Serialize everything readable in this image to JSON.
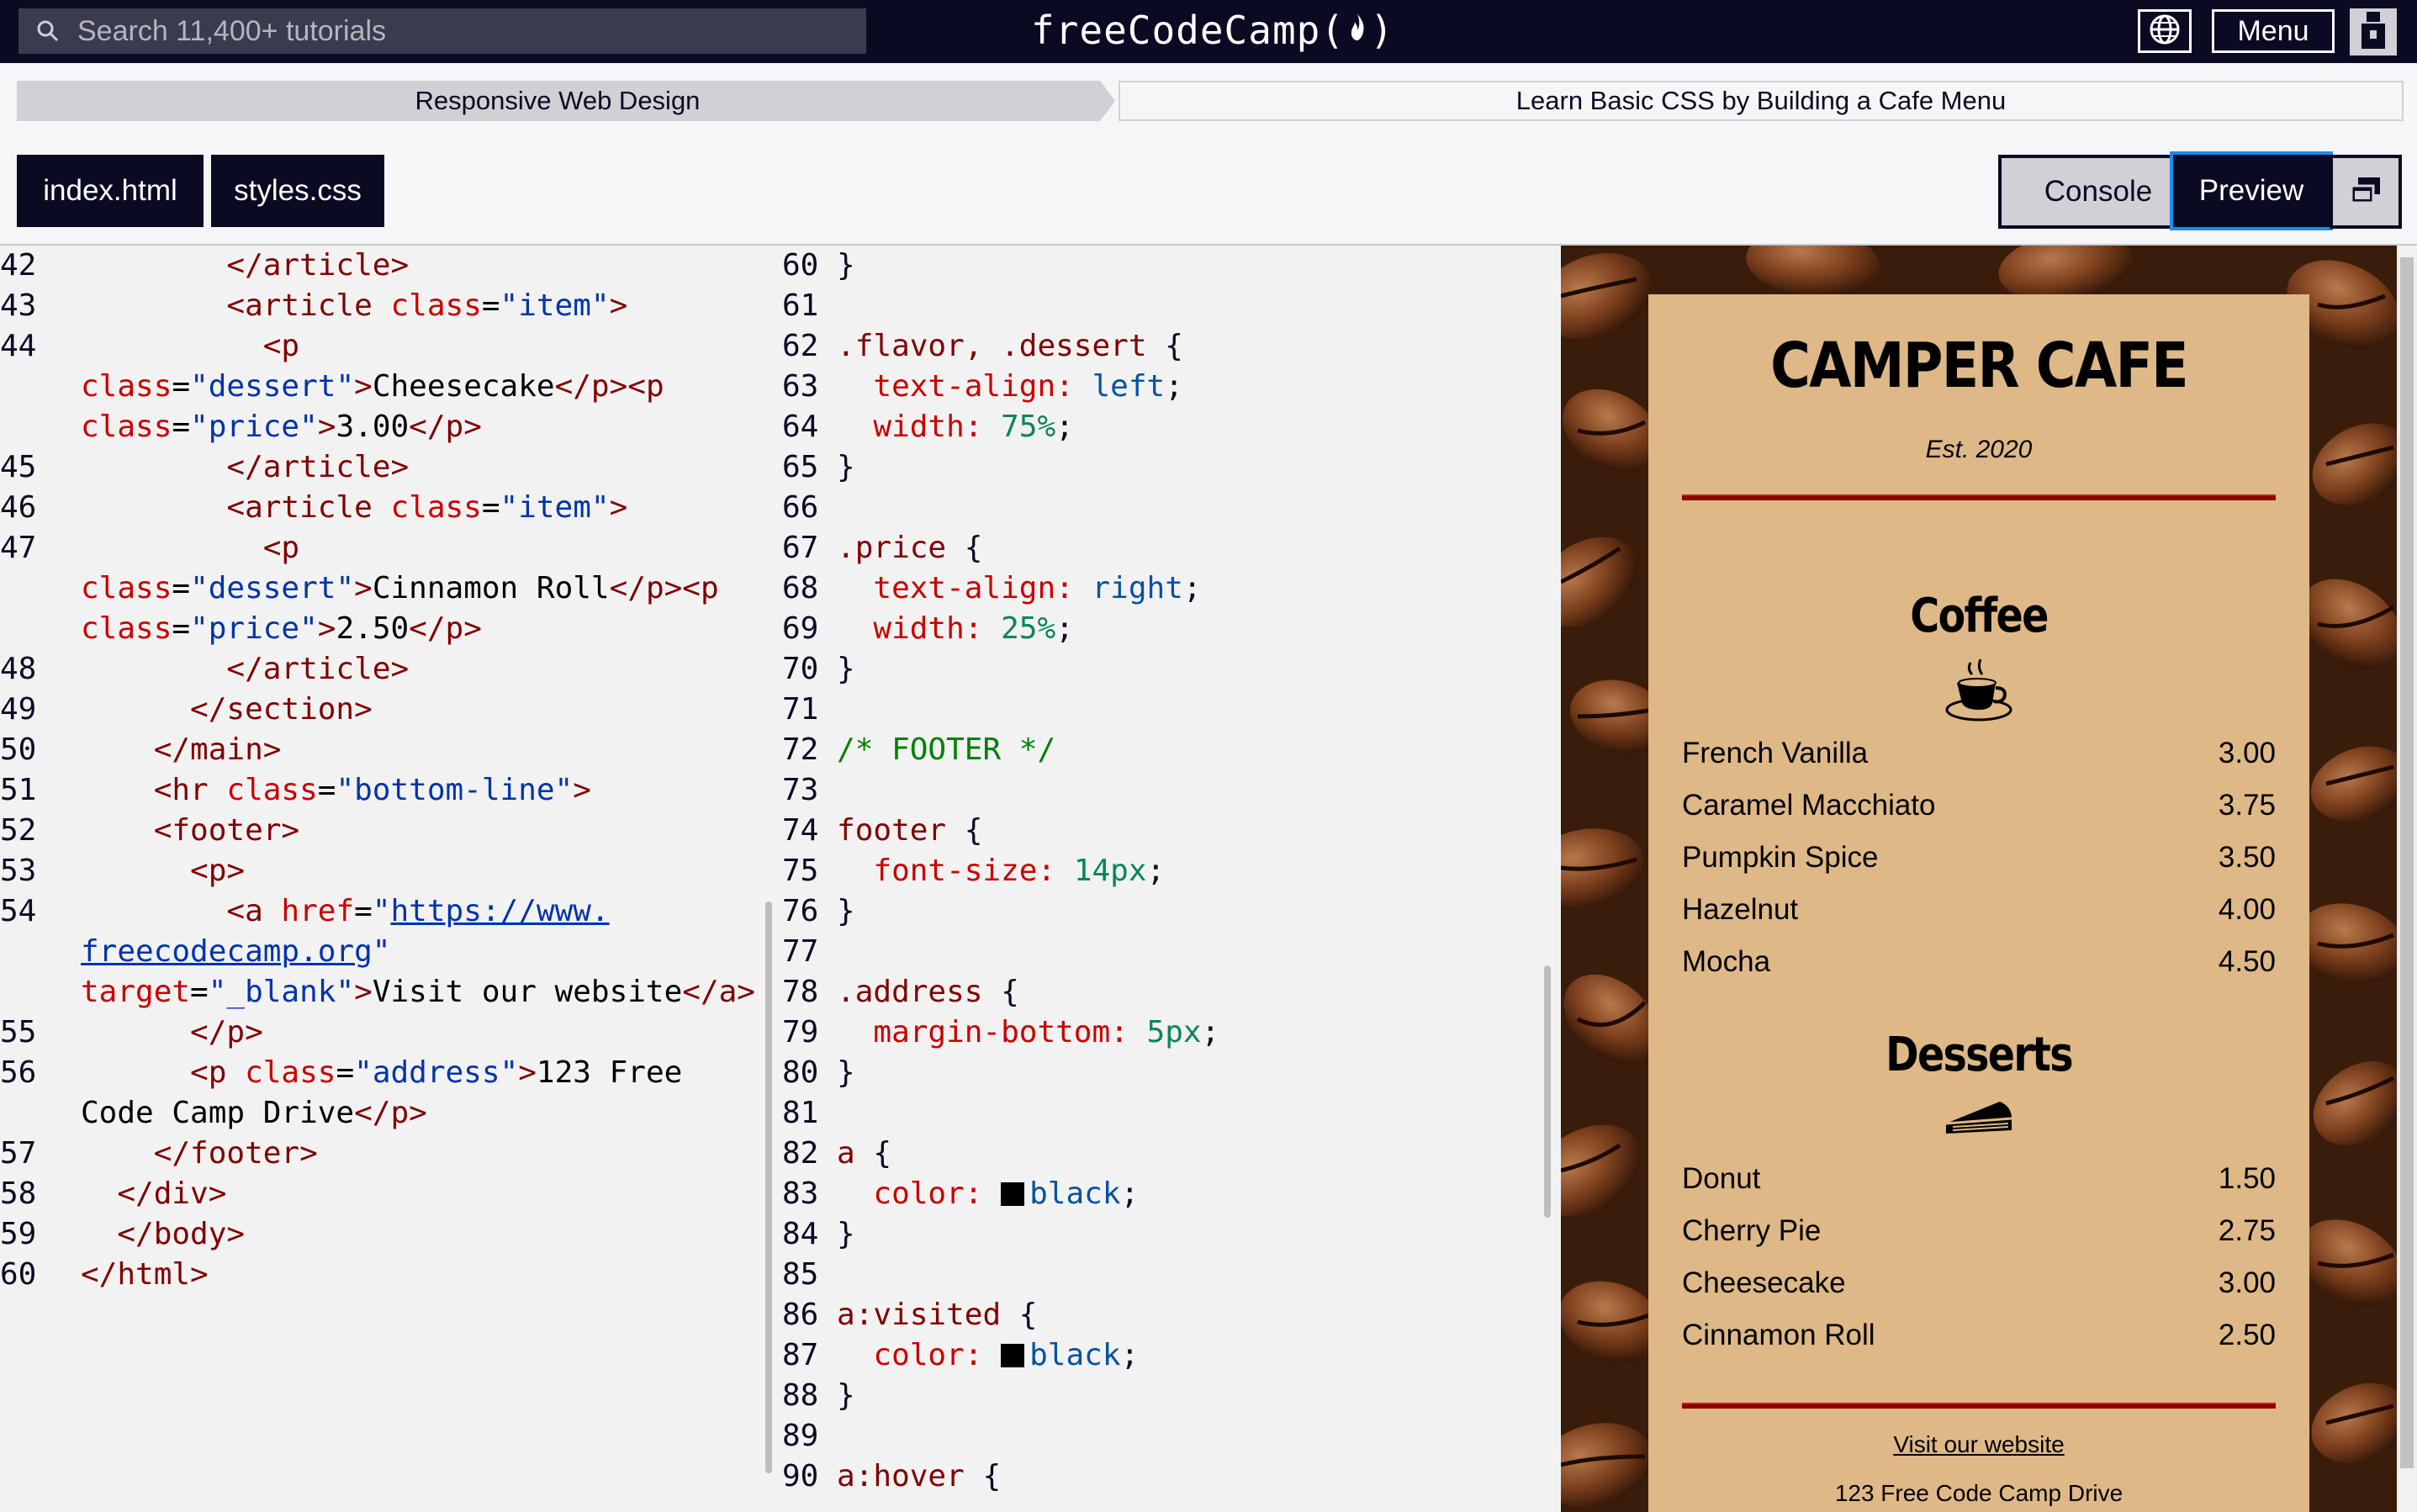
{
  "topnav": {
    "search_placeholder": "Search 11,400+ tutorials",
    "logo_text": "freeCodeCamp",
    "menu_label": "Menu"
  },
  "breadcrumb": {
    "superblock": "Responsive Web Design",
    "block": "Learn Basic CSS by Building a Cafe Menu"
  },
  "editor_tabs": [
    {
      "label": "index.html"
    },
    {
      "label": "styles.css"
    }
  ],
  "buttons": {
    "console": "Console",
    "preview": "Preview"
  },
  "html_editor": {
    "lines": [
      {
        "n": "42",
        "code": "        </article>"
      },
      {
        "n": "43",
        "code": "        <article class=\"item\">"
      },
      {
        "n": "44",
        "code": "          <p"
      },
      {
        "n": "",
        "code": "class=\"dessert\">Cheesecake</p><p"
      },
      {
        "n": "",
        "code": "class=\"price\">3.00</p>"
      },
      {
        "n": "45",
        "code": "        </article>"
      },
      {
        "n": "46",
        "code": "        <article class=\"item\">"
      },
      {
        "n": "47",
        "code": "          <p"
      },
      {
        "n": "",
        "code": "class=\"dessert\">Cinnamon Roll</p><p"
      },
      {
        "n": "",
        "code": "class=\"price\">2.50</p>"
      },
      {
        "n": "48",
        "code": "        </article>"
      },
      {
        "n": "49",
        "code": "      </section>"
      },
      {
        "n": "50",
        "code": "    </main>"
      },
      {
        "n": "51",
        "code": "    <hr class=\"bottom-line\">"
      },
      {
        "n": "52",
        "code": "    <footer>"
      },
      {
        "n": "53",
        "code": "      <p>"
      },
      {
        "n": "54",
        "code": "        <a href=\"https://www."
      },
      {
        "n": "",
        "code": "freecodecamp.org\""
      },
      {
        "n": "",
        "code": "target=\"_blank\">Visit our website</a>"
      },
      {
        "n": "55",
        "code": "      </p>"
      },
      {
        "n": "56",
        "code": "      <p class=\"address\">123 Free"
      },
      {
        "n": "",
        "code": "Code Camp Drive</p>"
      },
      {
        "n": "57",
        "code": "    </footer>"
      },
      {
        "n": "58",
        "code": "  </div>"
      },
      {
        "n": "59",
        "code": "  </body>"
      },
      {
        "n": "60",
        "code": "</html>"
      }
    ]
  },
  "css_editor": {
    "lines": [
      {
        "n": "60",
        "code": "}"
      },
      {
        "n": "61",
        "code": ""
      },
      {
        "n": "62",
        "code": ".flavor, .dessert {"
      },
      {
        "n": "63",
        "code": "  text-align: left;"
      },
      {
        "n": "64",
        "code": "  width: 75%;"
      },
      {
        "n": "65",
        "code": "}"
      },
      {
        "n": "66",
        "code": ""
      },
      {
        "n": "67",
        "code": ".price {"
      },
      {
        "n": "68",
        "code": "  text-align: right;"
      },
      {
        "n": "69",
        "code": "  width: 25%;"
      },
      {
        "n": "70",
        "code": "}"
      },
      {
        "n": "71",
        "code": ""
      },
      {
        "n": "72",
        "code": "/* FOOTER */"
      },
      {
        "n": "73",
        "code": ""
      },
      {
        "n": "74",
        "code": "footer {"
      },
      {
        "n": "75",
        "code": "  font-size: 14px;"
      },
      {
        "n": "76",
        "code": "}"
      },
      {
        "n": "77",
        "code": ""
      },
      {
        "n": "78",
        "code": ".address {"
      },
      {
        "n": "79",
        "code": "  margin-bottom: 5px;"
      },
      {
        "n": "80",
        "code": "}"
      },
      {
        "n": "81",
        "code": ""
      },
      {
        "n": "82",
        "code": "a {"
      },
      {
        "n": "83",
        "code": "  color: black;"
      },
      {
        "n": "84",
        "code": "}"
      },
      {
        "n": "85",
        "code": ""
      },
      {
        "n": "86",
        "code": "a:visited {"
      },
      {
        "n": "87",
        "code": "  color: black;"
      },
      {
        "n": "88",
        "code": "}"
      },
      {
        "n": "89",
        "code": ""
      },
      {
        "n": "90",
        "code": "a:hover {"
      }
    ]
  },
  "preview": {
    "title": "CAMPER CAFE",
    "established": "Est. 2020",
    "coffee_heading": "Coffee",
    "coffee_items": [
      {
        "name": "French Vanilla",
        "price": "3.00"
      },
      {
        "name": "Caramel Macchiato",
        "price": "3.75"
      },
      {
        "name": "Pumpkin Spice",
        "price": "3.50"
      },
      {
        "name": "Hazelnut",
        "price": "4.00"
      },
      {
        "name": "Mocha",
        "price": "4.50"
      }
    ],
    "desserts_heading": "Desserts",
    "dessert_items": [
      {
        "name": "Donut",
        "price": "1.50"
      },
      {
        "name": "Cherry Pie",
        "price": "2.75"
      },
      {
        "name": "Cheesecake",
        "price": "3.00"
      },
      {
        "name": "Cinnamon Roll",
        "price": "2.50"
      }
    ],
    "footer_link": "Visit our website",
    "footer_address": "123 Free Code Camp Drive"
  },
  "colors": {
    "nav_bg": "#0a0a23",
    "preview_active": "#198eee",
    "menu_card": "#deb887",
    "hr": "#8b0000"
  }
}
